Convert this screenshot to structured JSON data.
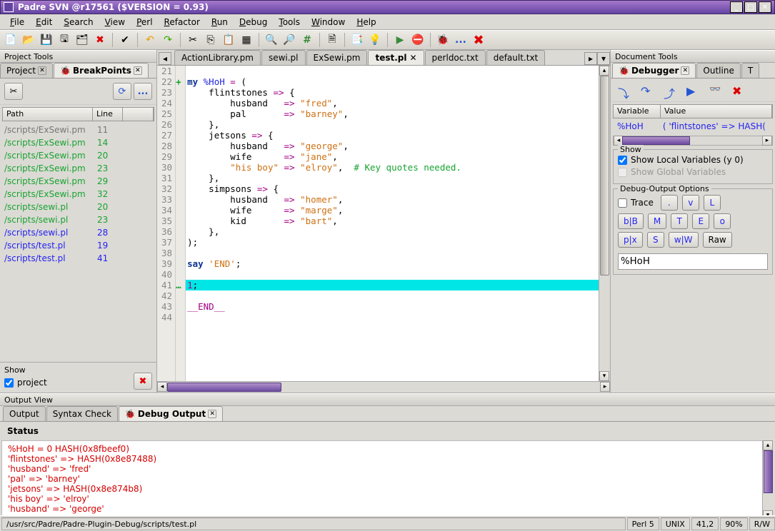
{
  "window": {
    "title": "Padre SVN @r17561 ($VERSION = 0.93)"
  },
  "menu": [
    "File",
    "Edit",
    "Search",
    "View",
    "Perl",
    "Refactor",
    "Run",
    "Debug",
    "Tools",
    "Window",
    "Help"
  ],
  "left": {
    "title": "Project Tools",
    "tabs": [
      {
        "label": "Project",
        "active": false
      },
      {
        "label": "BreakPoints",
        "active": true
      }
    ],
    "header": {
      "path": "Path",
      "line": "Line"
    },
    "rows": [
      {
        "p": "/scripts/ExSewi.pm",
        "l": "11",
        "cls": "bp-g"
      },
      {
        "p": "/scripts/ExSewi.pm",
        "l": "14",
        "cls": "bp-gr"
      },
      {
        "p": "/scripts/ExSewi.pm",
        "l": "20",
        "cls": "bp-gr"
      },
      {
        "p": "/scripts/ExSewi.pm",
        "l": "23",
        "cls": "bp-gr"
      },
      {
        "p": "/scripts/ExSewi.pm",
        "l": "29",
        "cls": "bp-gr"
      },
      {
        "p": "/scripts/ExSewi.pm",
        "l": "32",
        "cls": "bp-gr"
      },
      {
        "p": "/scripts/sewi.pl",
        "l": "20",
        "cls": "bp-gr"
      },
      {
        "p": "/scripts/sewi.pl",
        "l": "23",
        "cls": "bp-gr"
      },
      {
        "p": "/scripts/sewi.pl",
        "l": "28",
        "cls": "bp-bl"
      },
      {
        "p": "/scripts/test.pl",
        "l": "19",
        "cls": "bp-bl"
      },
      {
        "p": "/scripts/test.pl",
        "l": "41",
        "cls": "bp-bl"
      }
    ],
    "show": {
      "label": "Show",
      "project": "project"
    }
  },
  "editor": {
    "tabs": [
      "ActionLibrary.pm",
      "sewi.pl",
      "ExSewi.pm",
      "test.pl",
      "perldoc.txt",
      "default.txt"
    ],
    "active_tab": "test.pl",
    "lines": [
      {
        "n": 21,
        "h": ""
      },
      {
        "n": 22,
        "m": "+",
        "h": "<span class='kw'>my</span> <span class='var'>%HoH</span> <span class='op'>=</span> ("
      },
      {
        "n": 23,
        "h": "    flintstones <span class='op'>=&gt;</span> {"
      },
      {
        "n": 24,
        "h": "        husband   <span class='op'>=&gt;</span> <span class='str'>\"fred\"</span>,"
      },
      {
        "n": 25,
        "h": "        pal       <span class='op'>=&gt;</span> <span class='str'>\"barney\"</span>,"
      },
      {
        "n": 26,
        "h": "    },"
      },
      {
        "n": 27,
        "h": "    jetsons <span class='op'>=&gt;</span> {"
      },
      {
        "n": 28,
        "h": "        husband   <span class='op'>=&gt;</span> <span class='str'>\"george\"</span>,"
      },
      {
        "n": 29,
        "h": "        wife      <span class='op'>=&gt;</span> <span class='str'>\"jane\"</span>,"
      },
      {
        "n": 30,
        "h": "        <span class='str'>\"his boy\"</span> <span class='op'>=&gt;</span> <span class='str'>\"elroy\"</span>,  <span class='cmt'># Key quotes needed.</span>"
      },
      {
        "n": 31,
        "h": "    },"
      },
      {
        "n": 32,
        "h": "    simpsons <span class='op'>=&gt;</span> {"
      },
      {
        "n": 33,
        "h": "        husband   <span class='op'>=&gt;</span> <span class='str'>\"homer\"</span>,"
      },
      {
        "n": 34,
        "h": "        wife      <span class='op'>=&gt;</span> <span class='str'>\"marge\"</span>,"
      },
      {
        "n": 35,
        "h": "        kid       <span class='op'>=&gt;</span> <span class='str'>\"bart\"</span>,"
      },
      {
        "n": 36,
        "h": "    },"
      },
      {
        "n": 37,
        "h": ");"
      },
      {
        "n": 38,
        "h": ""
      },
      {
        "n": 39,
        "h": "<span class='kw'>say</span> <span class='str'>'END'</span>;"
      },
      {
        "n": 40,
        "h": ""
      },
      {
        "n": 41,
        "hl": true,
        "m": "…",
        "h": "<span class='op'>1</span>;"
      },
      {
        "n": 42,
        "h": ""
      },
      {
        "n": 43,
        "h": "<span class='op'>__END__</span>"
      },
      {
        "n": 44,
        "h": ""
      }
    ]
  },
  "right": {
    "title": "Document Tools",
    "tabs": [
      "Debugger",
      "Outline",
      "T"
    ],
    "var_header": {
      "v": "Variable",
      "val": "Value"
    },
    "var_row": {
      "v": "%HoH",
      "val": "(  'flintstones' => HASH("
    },
    "show": {
      "legend": "Show",
      "local": "Show Local Variables (y 0)",
      "global": "Show Global Variables"
    },
    "dout": {
      "legend": "Debug-Output Options",
      "trace": "Trace",
      "r1": [
        ".",
        "v",
        "L"
      ],
      "r2": [
        "b|B",
        "M",
        "T",
        "E",
        "o"
      ],
      "r3": [
        "p|x",
        "S",
        "w|W",
        "Raw"
      ]
    },
    "input": "%HoH"
  },
  "output": {
    "title": "Output View",
    "tabs": [
      "Output",
      "Syntax Check",
      "Debug Output"
    ],
    "status_label": "Status",
    "lines": [
      "%HoH = 0  HASH(0x8fbeef0)",
      "  'flintstones' => HASH(0x8e87488)",
      "    'husband' => 'fred'",
      "    'pal' => 'barney'",
      "  'jetsons' => HASH(0x8e874b8)",
      "    'his boy' => 'elroy'",
      "    'husband' => 'george'"
    ]
  },
  "status": {
    "path": "/usr/src/Padre/Padre-Plugin-Debug/scripts/test.pl",
    "lang": "Perl 5",
    "enc": "UNIX",
    "pos": "41,2",
    "zoom": "90%",
    "rw": "R/W"
  }
}
